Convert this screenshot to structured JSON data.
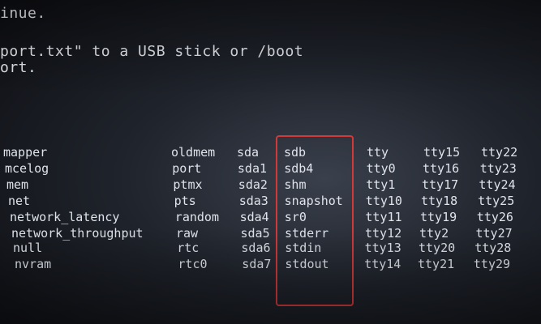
{
  "console": {
    "line1": "inue.",
    "line2": "port.txt\" to a USB stick or /boot",
    "line3": "ort."
  },
  "device_listing": {
    "columns": [
      [
        "mapper",
        "mcelog",
        "mem",
        "net",
        "network_latency",
        "network_throughput",
        "null",
        "nvram"
      ],
      [
        "oldmem",
        "port",
        "ptmx",
        "pts",
        "random",
        "raw",
        "rtc",
        "rtc0"
      ],
      [
        "sda",
        "sda1",
        "sda2",
        "sda3",
        "sda4",
        "sda5",
        "sda6",
        "sda7"
      ],
      [
        "sdb",
        "sdb4",
        "shm",
        "snapshot",
        "sr0",
        "stderr",
        "stdin",
        "stdout"
      ],
      [
        "tty",
        "tty0",
        "tty1",
        "tty10",
        "tty11",
        "tty12",
        "tty13",
        "tty14"
      ],
      [
        "tty15",
        "tty16",
        "tty17",
        "tty18",
        "tty19",
        "tty2",
        "tty20",
        "tty21"
      ],
      [
        "tty22",
        "tty23",
        "tty24",
        "tty25",
        "tty26",
        "tty27",
        "tty28",
        "tty29"
      ]
    ]
  },
  "highlight": {
    "color": "#d23a3a"
  }
}
